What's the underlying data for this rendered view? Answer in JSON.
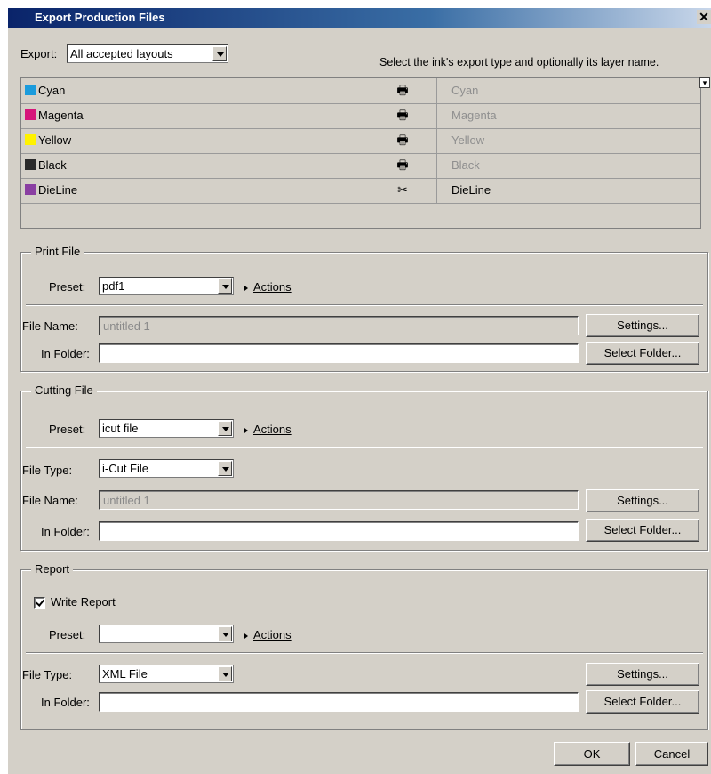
{
  "window": {
    "title": "Export Production Files"
  },
  "export": {
    "label": "Export:",
    "value": "All accepted layouts",
    "hint": "Select the ink's export type and optionally its layer name."
  },
  "inks": [
    {
      "name": "Cyan",
      "color": "#1a9bdc",
      "icon": "printer-icon",
      "layer": "Cyan",
      "dim": true
    },
    {
      "name": "Magenta",
      "color": "#d6157a",
      "icon": "printer-icon",
      "layer": "Magenta",
      "dim": true
    },
    {
      "name": "Yellow",
      "color": "#fff200",
      "icon": "printer-icon",
      "layer": "Yellow",
      "dim": true
    },
    {
      "name": "Black",
      "color": "#2a2a2a",
      "icon": "printer-icon",
      "layer": "Black",
      "dim": true
    },
    {
      "name": "DieLine",
      "color": "#8a3fa2",
      "icon": "cut-icon",
      "layer": "DieLine",
      "dim": false
    }
  ],
  "print_file": {
    "legend": "Print File",
    "preset_label": "Preset:",
    "preset_value": "pdf1",
    "actions_label": "Actions",
    "file_name_label": "File Name:",
    "file_name_value": "untitled 1",
    "folder_label": "In Folder:",
    "settings_label": "Settings...",
    "select_folder_label": "Select Folder..."
  },
  "cutting_file": {
    "legend": "Cutting File",
    "preset_label": "Preset:",
    "preset_value": "icut file",
    "actions_label": "Actions",
    "file_type_label": "File Type:",
    "file_type_value": "i-Cut File",
    "file_name_label": "File Name:",
    "file_name_value": "untitled 1",
    "folder_label": "In Folder:",
    "settings_label": "Settings...",
    "select_folder_label": "Select Folder..."
  },
  "report": {
    "legend": "Report",
    "write_report_label": "Write Report",
    "write_report_checked": true,
    "preset_label": "Preset:",
    "preset_value": "",
    "actions_label": "Actions",
    "file_type_label": "File Type:",
    "file_type_value": "XML File",
    "folder_label": "In Folder:",
    "settings_label": "Settings...",
    "select_folder_label": "Select Folder..."
  },
  "footer": {
    "ok_label": "OK",
    "cancel_label": "Cancel"
  }
}
